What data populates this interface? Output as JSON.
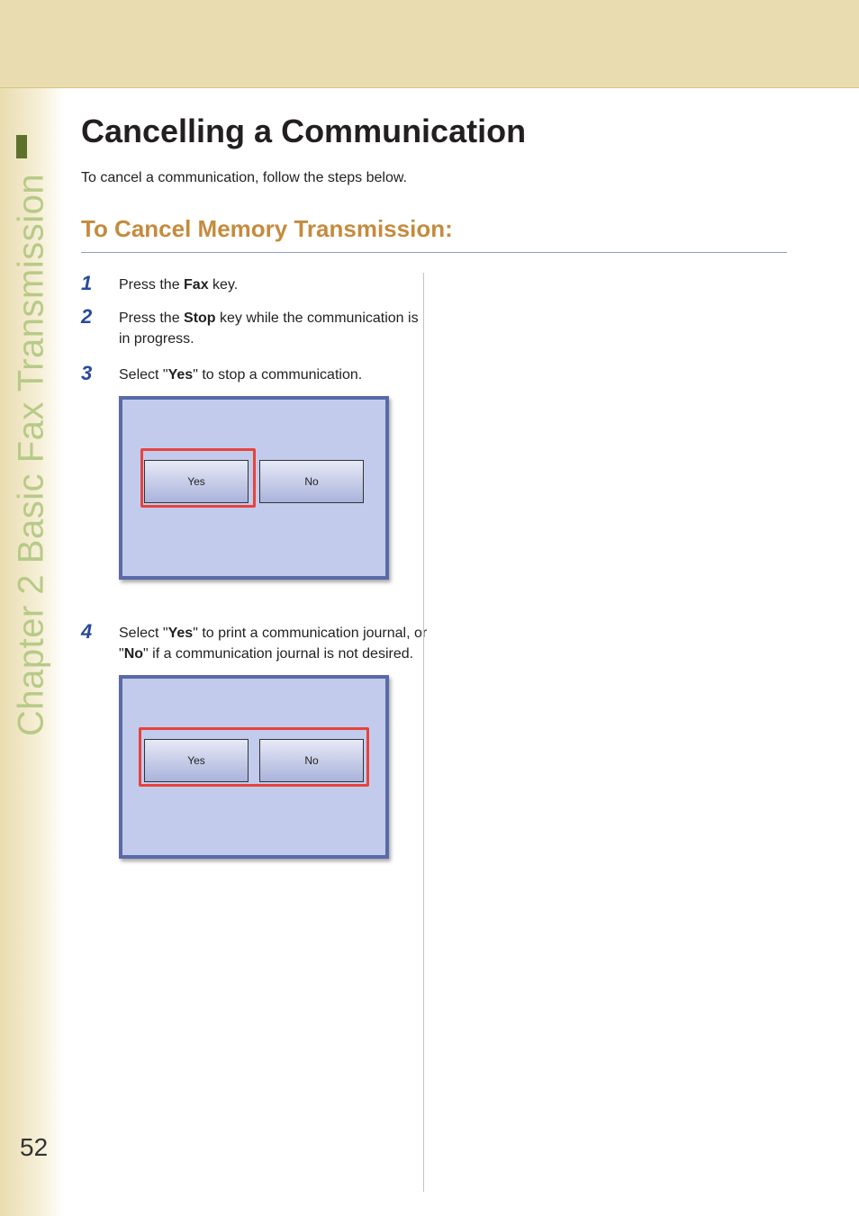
{
  "sidebar": {
    "label": "Chapter 2   Basic Fax Transmission"
  },
  "page_number": "52",
  "heading": "Cancelling a Communication",
  "intro": "To cancel a communication, follow the steps below.",
  "section_title": "To Cancel Memory Transmission:",
  "steps": [
    {
      "num": "1",
      "segments": [
        "Press the ",
        "Fax",
        " key."
      ]
    },
    {
      "num": "2",
      "segments": [
        "Press the ",
        "Stop",
        " key while the communication is in progress."
      ]
    },
    {
      "num": "3",
      "segments": [
        "Select \"",
        "Yes",
        "\" to stop a communication."
      ]
    },
    {
      "num": "4",
      "segments": [
        "Select \"",
        "Yes",
        "\" to print a communication journal, or \"",
        "No",
        "\" if a communication journal is not desired."
      ]
    }
  ],
  "panel1": {
    "yes": "Yes",
    "no": "No"
  },
  "panel2": {
    "yes": "Yes",
    "no": "No"
  }
}
